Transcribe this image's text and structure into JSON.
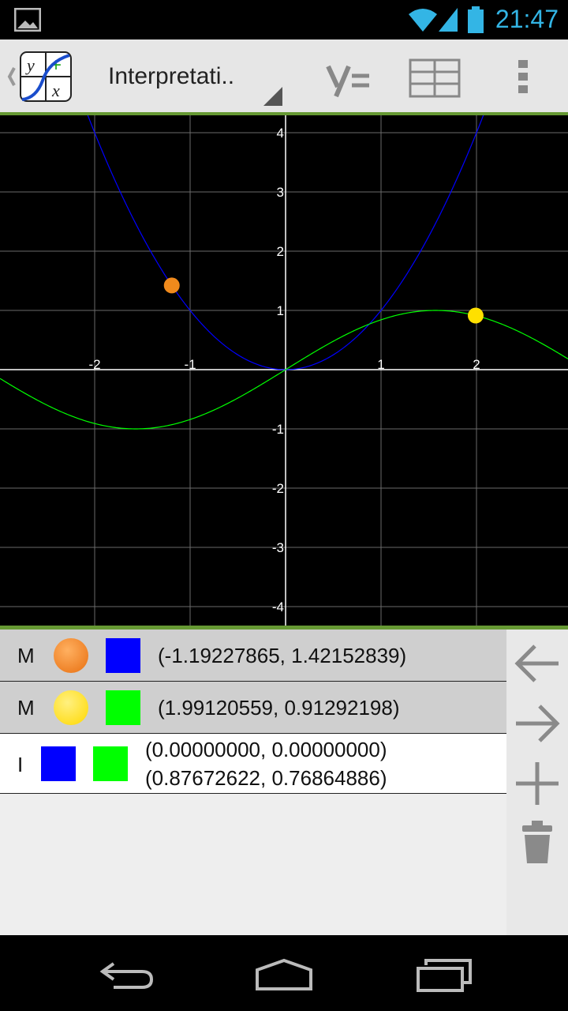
{
  "status": {
    "time": "21:47"
  },
  "actionbar": {
    "title": "Interpretati.."
  },
  "graph": {
    "x_ticks": [
      "-2",
      "-1",
      "1",
      "2"
    ],
    "y_ticks": [
      "4",
      "3",
      "2",
      "1",
      "-1",
      "-2",
      "-3",
      "-4"
    ],
    "curves": [
      {
        "expr": "x^2",
        "color": "#0000ff"
      },
      {
        "expr": "sin(x)",
        "color": "#00ff00"
      }
    ],
    "points": [
      {
        "x": -1.19227865,
        "y": 1.42152839,
        "color": "#f08a1c"
      },
      {
        "x": 1.99120559,
        "y": 0.91292198,
        "color": "#ffe000"
      }
    ]
  },
  "list": [
    {
      "kind": "M",
      "coords": [
        "(-1.19227865, 1.42152839)"
      ],
      "dot": "#f08a1c",
      "square": "#0000ff"
    },
    {
      "kind": "M",
      "coords": [
        "(1.99120559, 0.91292198)"
      ],
      "dot": "#ffe000",
      "square": "#00ff00"
    },
    {
      "kind": "I",
      "coords": [
        "(0.00000000, 0.00000000)",
        "(0.87672622, 0.76864886)"
      ],
      "sq1": "#0000ff",
      "sq2": "#00ff00"
    }
  ]
}
